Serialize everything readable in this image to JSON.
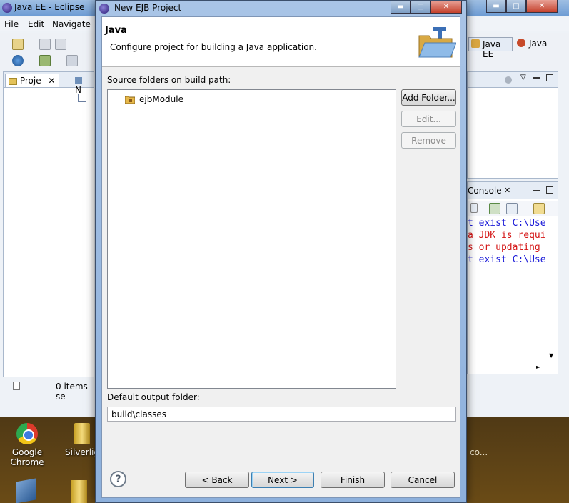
{
  "eclipse": {
    "title": "Java EE - Eclipse",
    "menu": [
      "File",
      "Edit",
      "Navigate"
    ],
    "perspectives": [
      "Java EE",
      "Java"
    ],
    "left_tabs": [
      "Proje",
      "N"
    ],
    "status_text": "0 items se",
    "console": {
      "tab": "Console",
      "lines": [
        {
          "text": "t exist C:\\Use",
          "color": "#1a1ad8"
        },
        {
          "text": "a JDK is requi",
          "color": "#d41515"
        },
        {
          "text": "s or updating ",
          "color": "#d41515"
        },
        {
          "text": "t exist C:\\Use",
          "color": "#1a1ad8"
        }
      ]
    }
  },
  "desktop": {
    "icons": [
      {
        "label_line1": "Google",
        "label_line2": "Chrome",
        "icon": "chrome-icon"
      },
      {
        "label_line1": "Silverlig",
        "label_line2": "",
        "icon": "folder-icon"
      }
    ],
    "partial_text": "co..."
  },
  "dialog": {
    "title": "New EJB Project",
    "header": {
      "title": "Java",
      "description": "Configure project for building a Java application."
    },
    "source_folders_label": "Source folders on build path:",
    "source_folders": [
      "ejbModule"
    ],
    "side_buttons": {
      "add_folder": "Add Folder...",
      "edit": "Edit...",
      "remove": "Remove"
    },
    "output_label": "Default output folder:",
    "output_value": "build\\classes",
    "buttons": {
      "back": "< Back",
      "next": "Next >",
      "finish": "Finish",
      "cancel": "Cancel"
    },
    "help_symbol": "?"
  }
}
